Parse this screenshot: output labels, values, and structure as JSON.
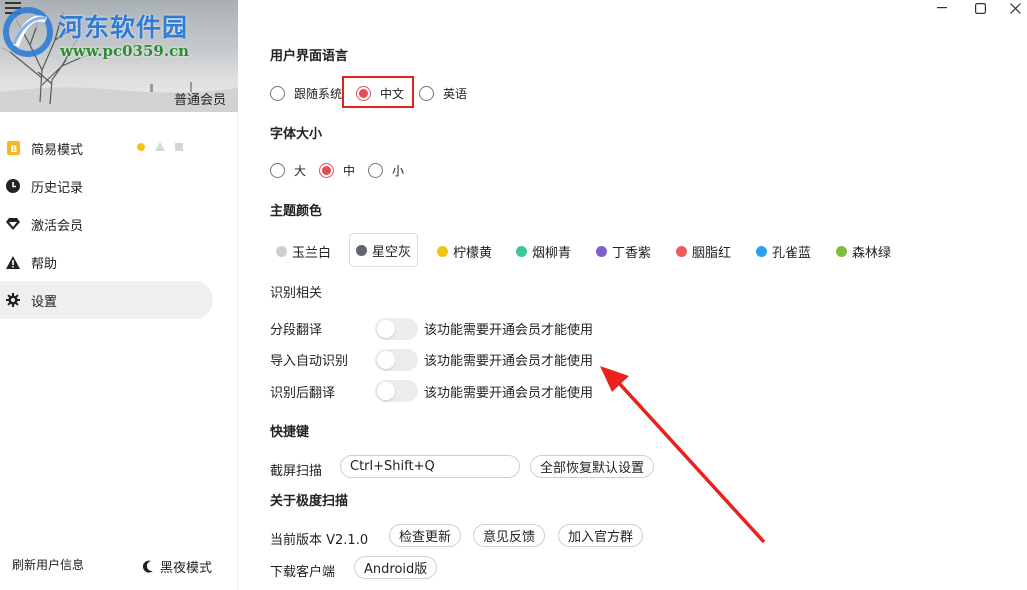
{
  "window": {
    "controls": [
      "minimize",
      "maximize",
      "close"
    ]
  },
  "sidebar": {
    "watermark_title": "河东软件园",
    "watermark_url": "www.pc0359.cn",
    "member_label": "普通会员",
    "items": [
      {
        "label": "简易模式",
        "icon": "mode-icon"
      },
      {
        "label": "历史记录",
        "icon": "clock-icon"
      },
      {
        "label": "激活会员",
        "icon": "diamond-icon"
      },
      {
        "label": "帮助",
        "icon": "warning-icon"
      },
      {
        "label": "设置",
        "icon": "gear-icon",
        "active": true
      }
    ],
    "refresh_label": "刷新用户信息",
    "dark_mode_label": "黑夜模式"
  },
  "settings": {
    "language": {
      "title": "用户界面语言",
      "options": [
        {
          "label": "跟随系统",
          "checked": false
        },
        {
          "label": "中文",
          "checked": true
        },
        {
          "label": "英语",
          "checked": false
        }
      ]
    },
    "font_size": {
      "title": "字体大小",
      "options": [
        {
          "label": "大",
          "checked": false
        },
        {
          "label": "中",
          "checked": true
        },
        {
          "label": "小",
          "checked": false
        }
      ]
    },
    "theme": {
      "title": "主题颜色",
      "options": [
        {
          "label": "玉兰白",
          "color": "#cfcfcf"
        },
        {
          "label": "星空灰",
          "color": "#5e6470",
          "selected": true
        },
        {
          "label": "柠檬黄",
          "color": "#f2c21b"
        },
        {
          "label": "烟柳青",
          "color": "#3dc59b"
        },
        {
          "label": "丁香紫",
          "color": "#7e5fd0"
        },
        {
          "label": "胭脂红",
          "color": "#ef5b5b"
        },
        {
          "label": "孔雀蓝",
          "color": "#2f9ef0"
        },
        {
          "label": "森林绿",
          "color": "#7bbf3c"
        }
      ]
    },
    "recognition": {
      "title": "识别相关",
      "rows": [
        {
          "label": "分段翻译",
          "note": "该功能需要开通会员才能使用",
          "on": false
        },
        {
          "label": "导入自动识别",
          "note": "该功能需要开通会员才能使用",
          "on": false
        },
        {
          "label": "识别后翻译",
          "note": "该功能需要开通会员才能使用",
          "on": false
        }
      ]
    },
    "shortcuts": {
      "title": "快捷键",
      "screenshot_label": "截屏扫描",
      "screenshot_value": "Ctrl+Shift+Q",
      "reset_button": "全部恢复默认设置"
    },
    "about": {
      "title": "关于极度扫描",
      "version_label": "当前版本 V2.1.0",
      "check_update": "检查更新",
      "feedback": "意见反馈",
      "join_group": "加入官方群",
      "download_label": "下载客户端",
      "android": "Android版"
    }
  },
  "colors": {
    "accent": "#e84b55",
    "highlight_box": "#e2241f",
    "arrow": "#e8221d"
  }
}
